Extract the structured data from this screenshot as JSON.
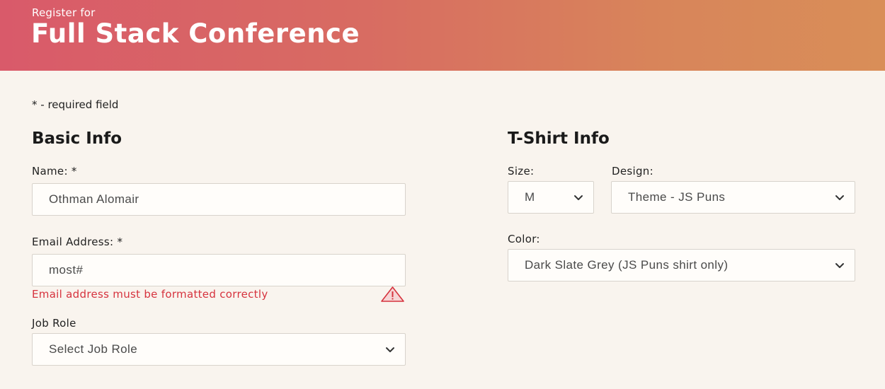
{
  "header": {
    "subtitle": "Register for",
    "title": "Full Stack Conference",
    "gradient_start": "#d95a6a",
    "gradient_end": "#d98e58"
  },
  "form": {
    "required_note": "* - required field",
    "basic_info": {
      "heading": "Basic Info",
      "name_label": "Name: *",
      "name_value": "Othman Alomair",
      "email_label": "Email Address: *",
      "email_value": "most#",
      "email_error": "Email address must be formatted correctly",
      "error_color": "#d6333e",
      "job_role_label": "Job Role",
      "job_role_value": "Select Job Role"
    },
    "tshirt_info": {
      "heading": "T-Shirt Info",
      "size_label": "Size:",
      "size_value": "M",
      "design_label": "Design:",
      "design_value": "Theme - JS Puns",
      "color_label": "Color:",
      "color_value": "Dark Slate Grey (JS Puns shirt only)"
    }
  },
  "icons": {
    "dropdown": "chevron-down-icon",
    "error": "warning-triangle-icon"
  }
}
